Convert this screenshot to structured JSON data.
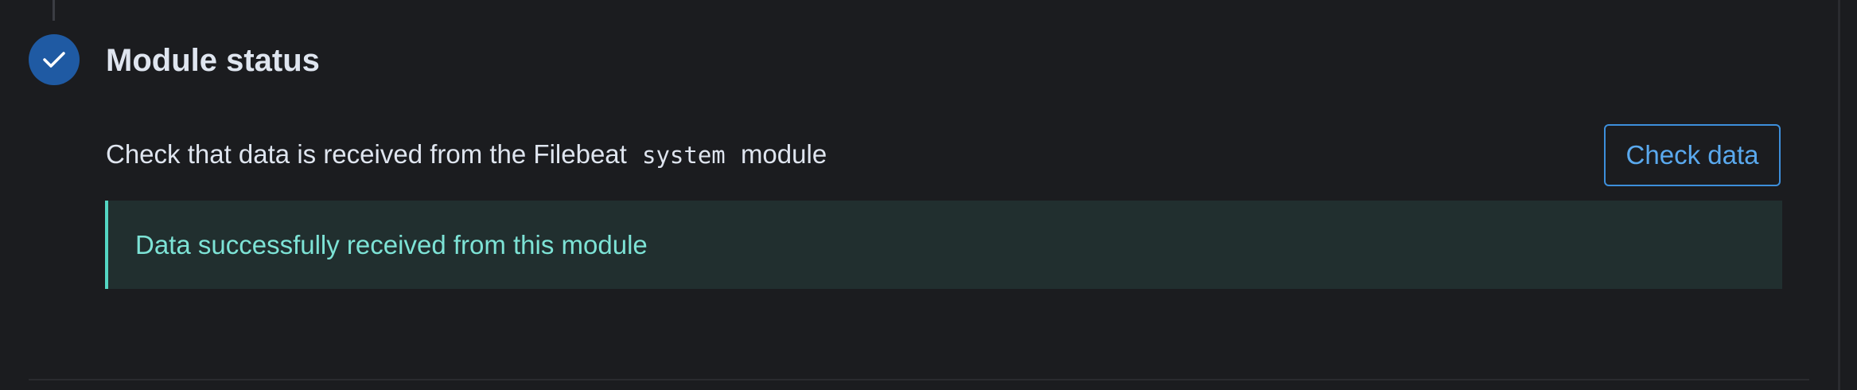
{
  "step": {
    "icon": "check-icon",
    "title": "Module status",
    "status_color": "#1f5aa3"
  },
  "check": {
    "description_before": "Check that data is received from the Filebeat",
    "module_code": "system",
    "description_after": "module",
    "button_label": "Check data"
  },
  "callout": {
    "message": "Data successfully received from this module",
    "color": "#54d6c3"
  }
}
